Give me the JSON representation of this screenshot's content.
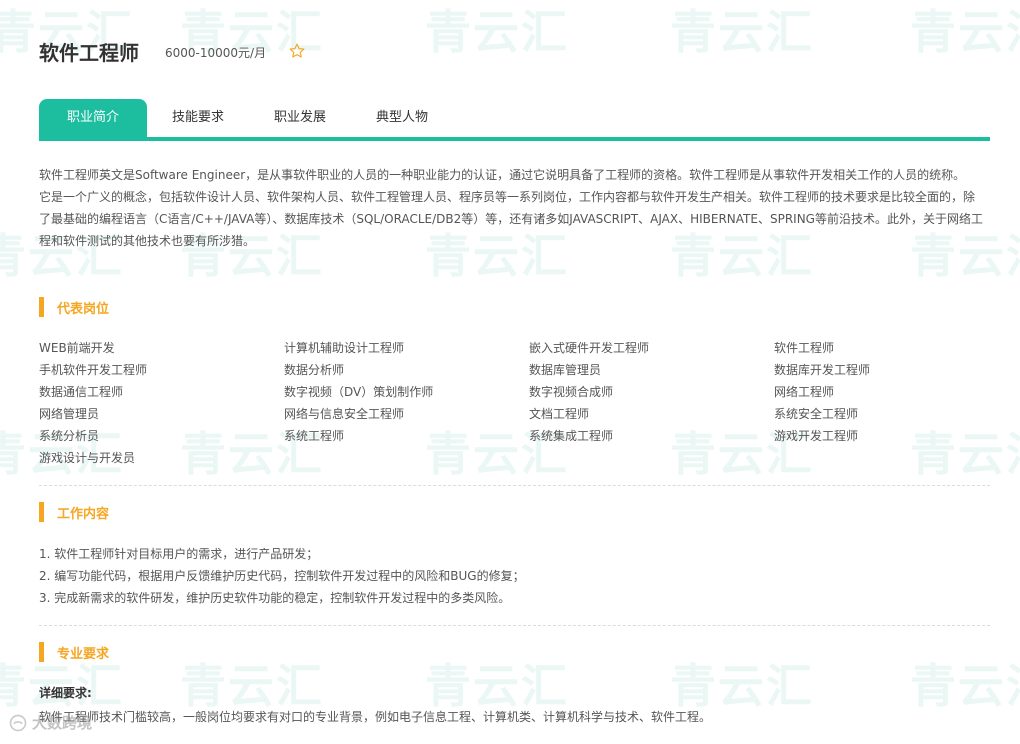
{
  "header": {
    "title": "软件工程师",
    "salary": "6000-10000元/月"
  },
  "tabs": [
    {
      "label": "职业简介"
    },
    {
      "label": "技能要求"
    },
    {
      "label": "职业发展"
    },
    {
      "label": "典型人物"
    }
  ],
  "intro": {
    "p1": "软件工程师英文是Software Engineer，是从事软件职业的人员的一种职业能力的认证，通过它说明具备了工程师的资格。软件工程师是从事软件开发相关工作的人员的统称。",
    "p2": "它是一个广义的概念，包括软件设计人员、软件架构人员、软件工程管理人员、程序员等一系列岗位，工作内容都与软件开发生产相关。软件工程师的技术要求是比较全面的，除了最基础的编程语言（C语言/C++/JAVA等）、数据库技术（SQL/ORACLE/DB2等）等，还有诸多如JAVASCRIPT、AJAX、HIBERNATE、SPRING等前沿技术。此外，关于网络工程和软件测试的其他技术也要有所涉猎。"
  },
  "positions": {
    "heading": "代表岗位",
    "items": [
      "WEB前端开发",
      "计算机辅助设计工程师",
      "嵌入式硬件开发工程师",
      "软件工程师",
      "手机软件开发工程师",
      "数据分析师",
      "数据库管理员",
      "数据库开发工程师",
      "数据通信工程师",
      "数字视频（DV）策划制作师",
      "数字视频合成师",
      "网络工程师",
      "网络管理员",
      "网络与信息安全工程师",
      "文档工程师",
      "系统安全工程师",
      "系统分析员",
      "系统工程师",
      "系统集成工程师",
      "游戏开发工程师",
      "游戏设计与开发员"
    ]
  },
  "work": {
    "heading": "工作内容",
    "items": [
      "1. 软件工程师针对目标用户的需求，进行产品研发；",
      "2. 编写功能代码，根据用户反馈维护历史代码，控制软件开发过程中的风险和BUG的修复；",
      "3. 完成新需求的软件研发，维护历史软件功能的稳定，控制软件开发过程中的多类风险。"
    ]
  },
  "requirements": {
    "heading": "专业要求",
    "detail_label": "详细要求:",
    "detail_text": "软件工程师技术门槛较高，一般岗位均要求有对口的专业背景，例如电子信息工程、计算机类、计算机科学与技术、软件工程。"
  },
  "watermark": {
    "text": "青云汇",
    "corner_text": "大数跨境"
  },
  "colors": {
    "accent": "#1dbe9f",
    "section": "#f5a623",
    "star": "#f5a623"
  },
  "icons": {
    "favorite": "star-outline-icon",
    "watermark_logo": "cloud-logo-icon"
  }
}
